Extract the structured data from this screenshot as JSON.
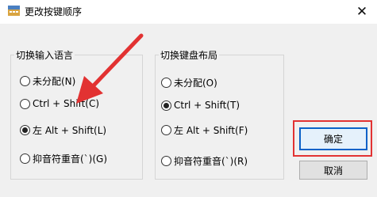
{
  "window": {
    "title": "更改按键顺序",
    "close_glyph": "✕"
  },
  "input_language_group": {
    "legend": "切换输入语言",
    "options": [
      {
        "label": "未分配(N)",
        "selected": false
      },
      {
        "label": "Ctrl + Shift(C)",
        "selected": false
      },
      {
        "label": "左 Alt + Shift(L)",
        "selected": true
      },
      {
        "label": "抑音符重音(`)(G)",
        "selected": false
      }
    ]
  },
  "keyboard_layout_group": {
    "legend": "切换键盘布局",
    "options": [
      {
        "label": "未分配(O)",
        "selected": false
      },
      {
        "label": "Ctrl + Shift(T)",
        "selected": true
      },
      {
        "label": "左 Alt + Shift(F)",
        "selected": false
      },
      {
        "label": "抑音符重音(`)(R)",
        "selected": false
      }
    ]
  },
  "buttons": {
    "ok": "确定",
    "cancel": "取消"
  },
  "annotation": {
    "arrow_color": "#e23232",
    "box_color": "#e23232"
  }
}
